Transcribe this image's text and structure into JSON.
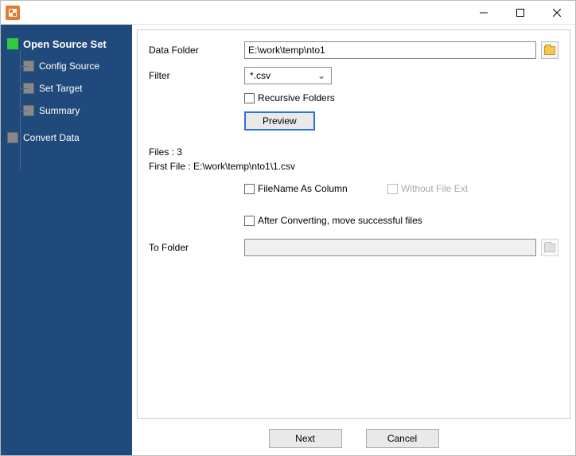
{
  "sidebar": {
    "root_label": "Open Source Set",
    "items": [
      {
        "label": "Config Source"
      },
      {
        "label": "Set Target"
      },
      {
        "label": "Summary"
      }
    ],
    "convert_label": "Convert Data"
  },
  "form": {
    "data_folder_label": "Data Folder",
    "data_folder_value": "E:\\work\\temp\\nto1",
    "filter_label": "Filter",
    "filter_value": "*.csv",
    "recursive_label": "Recursive Folders",
    "preview_label": "Preview",
    "files_line": "Files : 3",
    "first_file_line": "First File : E:\\work\\temp\\nto1\\1.csv",
    "filename_col_label": "FileName As Column",
    "without_ext_label": "Without File Ext",
    "after_convert_label": "After Converting, move successful files",
    "to_folder_label": "To Folder"
  },
  "footer": {
    "next_label": "Next",
    "cancel_label": "Cancel"
  }
}
